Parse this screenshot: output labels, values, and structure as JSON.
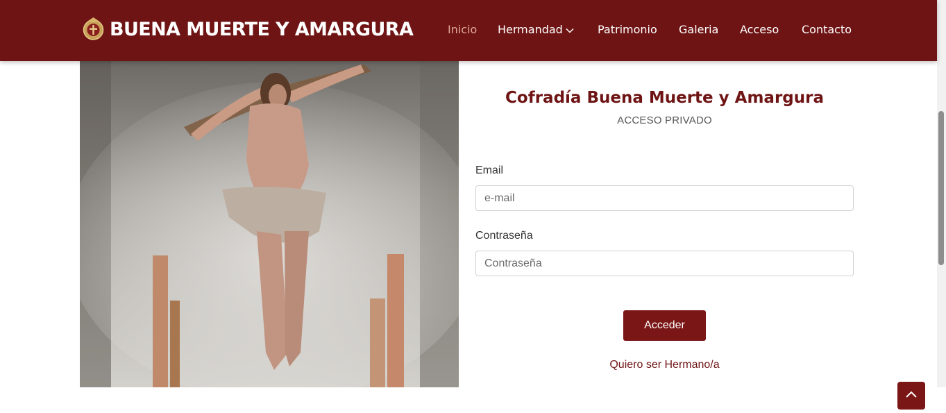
{
  "header": {
    "brand_title": "BUENA MUERTE Y AMARGURA",
    "nav": [
      {
        "label": "Inicio",
        "active": true
      },
      {
        "label": "Hermandad",
        "dropdown": true
      },
      {
        "label": "Patrimonio"
      },
      {
        "label": "Galeria"
      },
      {
        "label": "Acceso"
      },
      {
        "label": "Contacto"
      }
    ]
  },
  "login": {
    "title": "Cofradía Buena Muerte y Amargura",
    "subtitle": "ACCESO PRIVADO",
    "email_label": "Email",
    "email_placeholder": "e-mail",
    "password_label": "Contraseña",
    "password_placeholder": "Contraseña",
    "submit_label": "Acceder",
    "join_link": "Quiero ser Hermano/a"
  },
  "colors": {
    "brand": "#6f1414",
    "nav_active": "#e0a89a",
    "button": "#7a1616"
  },
  "icons": {
    "logo": "brotherhood-crest-icon",
    "dropdown": "chevron-down-icon",
    "back_to_top": "arrow-up-icon"
  }
}
